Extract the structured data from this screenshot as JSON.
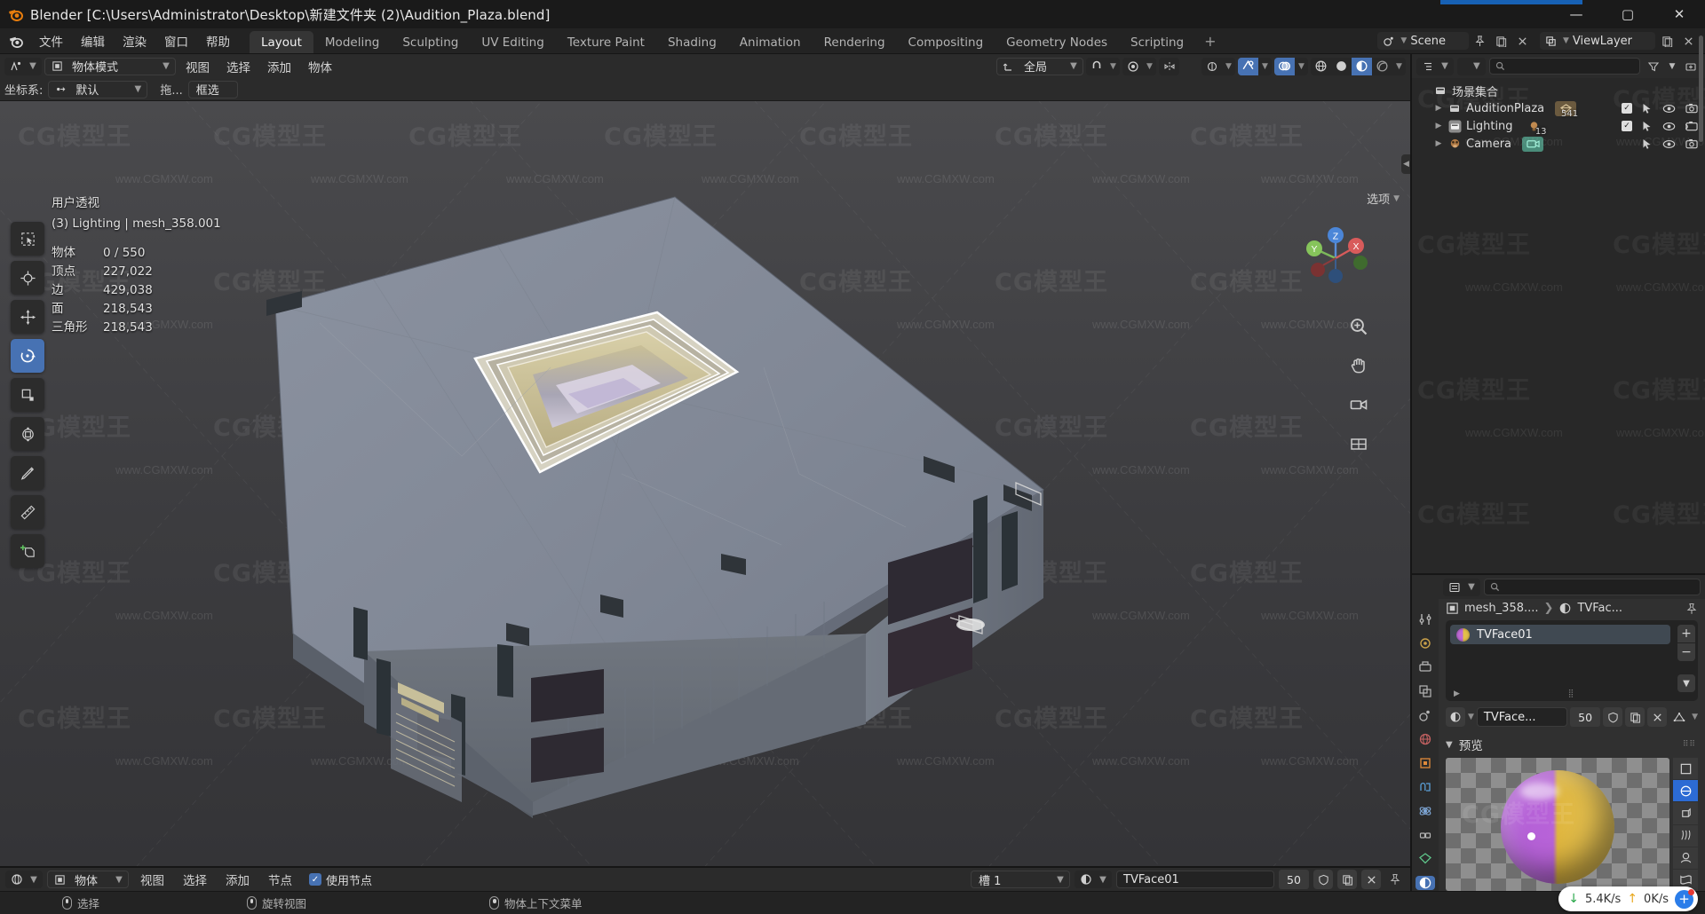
{
  "window": {
    "title": "Blender [C:\\Users\\Administrator\\Desktop\\新建文件夹 (2)\\Audition_Plaza.blend]",
    "minimize": "—",
    "maximize": "▢",
    "close": "✕"
  },
  "topbar": {
    "menus": [
      "文件",
      "编辑",
      "渲染",
      "窗口",
      "帮助"
    ],
    "tabs": [
      {
        "label": "Layout",
        "active": true
      },
      {
        "label": "Modeling",
        "active": false
      },
      {
        "label": "Sculpting",
        "active": false
      },
      {
        "label": "UV Editing",
        "active": false
      },
      {
        "label": "Texture Paint",
        "active": false
      },
      {
        "label": "Shading",
        "active": false
      },
      {
        "label": "Animation",
        "active": false
      },
      {
        "label": "Rendering",
        "active": false
      },
      {
        "label": "Compositing",
        "active": false
      },
      {
        "label": "Geometry Nodes",
        "active": false
      },
      {
        "label": "Scripting",
        "active": false
      }
    ],
    "add_tab": "+",
    "scene_name": "Scene",
    "viewlayer_name": "ViewLayer"
  },
  "viewport_header": {
    "mode": "物体模式",
    "menus": [
      "视图",
      "选择",
      "添加",
      "物体"
    ],
    "transform_orientation": "全局",
    "coordinate_label": "坐标系:",
    "coordinate_value": "默认",
    "drag_label": "拖...",
    "select_mode": "框选",
    "options_label": "选项"
  },
  "overlay_stats": {
    "view_name": "用户透视",
    "object_path": "(3) Lighting | mesh_358.001",
    "rows": [
      {
        "label": "物体",
        "value": "0 / 550"
      },
      {
        "label": "顶点",
        "value": "227,022"
      },
      {
        "label": "边",
        "value": "429,038"
      },
      {
        "label": "面",
        "value": "218,543"
      },
      {
        "label": "三角形",
        "value": "218,543"
      }
    ]
  },
  "toolbar": {
    "tools": [
      {
        "name": "tweak-tool",
        "active": false
      },
      {
        "name": "cursor-tool",
        "active": false
      },
      {
        "name": "move-tool",
        "active": false
      },
      {
        "name": "rotate-tool",
        "active": true
      },
      {
        "name": "scale-tool",
        "active": false
      },
      {
        "name": "transform-tool",
        "active": false
      },
      {
        "name": "annotate-tool",
        "active": false
      },
      {
        "name": "measure-tool",
        "active": false
      },
      {
        "name": "add-cube-tool",
        "active": false
      }
    ]
  },
  "gizmo": {
    "axes": [
      "Z",
      "X",
      "Y"
    ]
  },
  "outliner": {
    "search_placeholder": "",
    "rows": [
      {
        "name": "场景集合",
        "icon": "collection-icon",
        "depth": 0,
        "badge": "",
        "count": "",
        "has_checkbox": false,
        "has_arrow": false
      },
      {
        "name": "AuditionPlaza",
        "icon": "collection-icon",
        "depth": 1,
        "badge": "mesh-icon",
        "count": "541",
        "has_checkbox": true,
        "has_arrow": true
      },
      {
        "name": "Lighting",
        "icon": "collection-icon-active",
        "depth": 1,
        "badge": "light-icon",
        "count": "13",
        "has_checkbox": true,
        "has_arrow": true
      },
      {
        "name": "Camera",
        "icon": "camera-obj-icon",
        "depth": 1,
        "badge": "camera-icon",
        "count": "",
        "has_checkbox": false,
        "has_arrow": true
      }
    ]
  },
  "properties": {
    "breadcrumb": [
      "mesh_358....",
      "TVFac..."
    ],
    "slot_name": "TVFace01",
    "material_field": "TVFace...",
    "users_count": "50",
    "preview_title": "预览",
    "add_slot": "+",
    "remove_slot": "−"
  },
  "shader_editor": {
    "mode": "物体",
    "menus": [
      "视图",
      "选择",
      "添加",
      "节点"
    ],
    "use_nodes_label": "使用节点",
    "use_nodes_checked": true,
    "slot_label": "槽 1",
    "material_name": "TVFace01",
    "users_count": "50"
  },
  "statusbar": {
    "items": [
      {
        "icon": "mouse-left-icon",
        "label": "选择"
      },
      {
        "icon": "mouse-middle-icon",
        "label": "旋转视图"
      },
      {
        "icon": "mouse-right-icon",
        "label": "物体上下文菜单"
      }
    ],
    "network": {
      "down": "5.4K/s",
      "up": "0K/s",
      "down_arrow": "↓",
      "up_arrow": "↑",
      "badge": "+"
    }
  },
  "watermarks": {
    "small": "www.CGMXW.com",
    "brand": "CG模型王"
  },
  "colors": {
    "accent_blue": "#4772b3",
    "header_bg": "#2b2b2b",
    "viewport_bg": "#3c3c3f",
    "panel_bg": "#303030",
    "title_bg": "#1a1a1a"
  }
}
